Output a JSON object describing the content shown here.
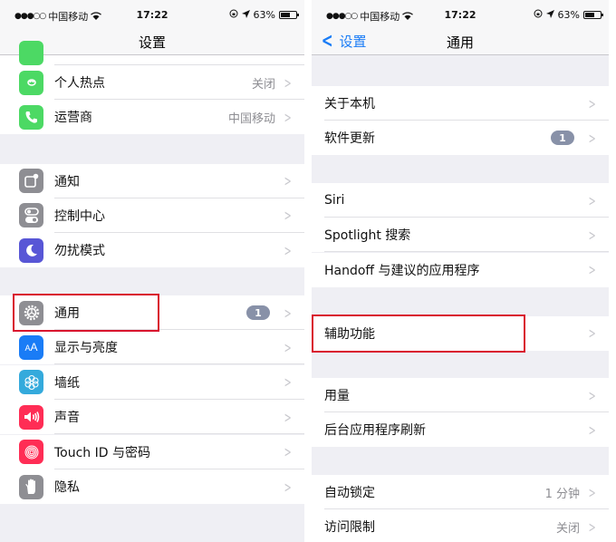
{
  "status_bar": {
    "signal": "●●●○○",
    "carrier": "中国移动",
    "wifi_icon": "wifi-icon",
    "time": "17:22",
    "orientation_lock_icon": "orientation-lock-icon",
    "location_icon": "location-arrow-icon",
    "battery_percent": "63%",
    "battery_level": 0.63
  },
  "left_screen": {
    "title": "设置",
    "groups": [
      {
        "items": [
          {
            "label": "个人热点",
            "value": "关闭",
            "icon": "hotspot-icon",
            "icon_color": "#4cd964"
          },
          {
            "label": "运营商",
            "value": "中国移动",
            "icon": "phone-icon",
            "icon_color": "#4cd964"
          }
        ]
      },
      {
        "items": [
          {
            "label": "通知",
            "icon": "notifications-icon",
            "icon_color": "#8e8e93"
          },
          {
            "label": "控制中心",
            "icon": "control-center-icon",
            "icon_color": "#8e8e93"
          },
          {
            "label": "勿扰模式",
            "icon": "moon-icon",
            "icon_color": "#5856d6"
          }
        ]
      },
      {
        "items": [
          {
            "label": "通用",
            "icon": "gear-icon",
            "icon_color": "#8e8e93",
            "badge": "1",
            "highlighted": true
          },
          {
            "label": "显示与亮度",
            "icon": "display-brightness-icon",
            "icon_color": "#1a7cf6",
            "icon_text": "AA"
          },
          {
            "label": "墙纸",
            "icon": "wallpaper-icon",
            "icon_color": "#34aadc"
          },
          {
            "label": "声音",
            "icon": "speaker-icon",
            "icon_color": "#ff2d55"
          },
          {
            "label": "Touch ID 与密码",
            "icon": "fingerprint-icon",
            "icon_color": "#ff2d55"
          },
          {
            "label": "隐私",
            "icon": "hand-icon",
            "icon_color": "#8e8e93"
          }
        ]
      }
    ]
  },
  "right_screen": {
    "back_label": "设置",
    "title": "通用",
    "groups": [
      {
        "items": [
          {
            "label": "关于本机"
          },
          {
            "label": "软件更新",
            "badge": "1"
          }
        ]
      },
      {
        "items": [
          {
            "label": "Siri"
          },
          {
            "label": "Spotlight 搜索"
          },
          {
            "label": "Handoff 与建议的应用程序"
          }
        ]
      },
      {
        "items": [
          {
            "label": "辅助功能",
            "highlighted": true
          }
        ]
      },
      {
        "items": [
          {
            "label": "用量"
          },
          {
            "label": "后台应用程序刷新"
          }
        ]
      },
      {
        "items": [
          {
            "label": "自动锁定",
            "value": "1 分钟"
          },
          {
            "label": "访问限制",
            "value": "关闭"
          }
        ]
      }
    ]
  },
  "chevron_glyph": ">",
  "highlight_color": "#d9112e"
}
